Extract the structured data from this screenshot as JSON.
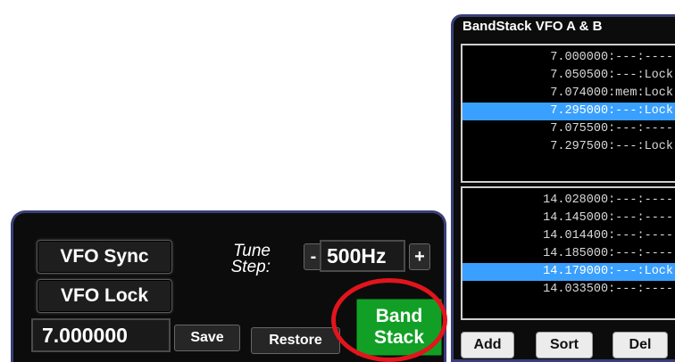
{
  "vfo_panel": {
    "vfo_sync_label": "VFO Sync",
    "vfo_lock_label": "VFO Lock",
    "frequency": "7.000000",
    "save_label": "Save",
    "restore_label": "Restore",
    "tune_step_label": "Tune Step:",
    "step_minus": "-",
    "step_value": "500Hz",
    "step_plus": "+",
    "band_stack_label_line1": "Band",
    "band_stack_label_line2": "Stack",
    "band_stack_color": "#11a025",
    "highlight_color": "#e3141c"
  },
  "bandstack": {
    "title": "BandStack VFO A & B",
    "list_a": [
      {
        "text": "7.000000:---:----",
        "selected": false
      },
      {
        "text": "7.050500:---:Lock",
        "selected": false
      },
      {
        "text": "7.074000:mem:Lock",
        "selected": false
      },
      {
        "text": "7.295000:---:Lock",
        "selected": true
      },
      {
        "text": "7.075500:---:----",
        "selected": false
      },
      {
        "text": "7.297500:---:Lock",
        "selected": false
      }
    ],
    "list_b": [
      {
        "text": "14.028000:---:----",
        "selected": false
      },
      {
        "text": "14.145000:---:----",
        "selected": false
      },
      {
        "text": "14.014400:---:----",
        "selected": false
      },
      {
        "text": "14.185000:---:----",
        "selected": false
      },
      {
        "text": "14.179000:---:Lock",
        "selected": true
      },
      {
        "text": "14.033500:---:----",
        "selected": false
      }
    ],
    "add_label": "Add",
    "sort_label": "Sort",
    "del_label": "Del",
    "selection_color": "#3aa0ff"
  }
}
